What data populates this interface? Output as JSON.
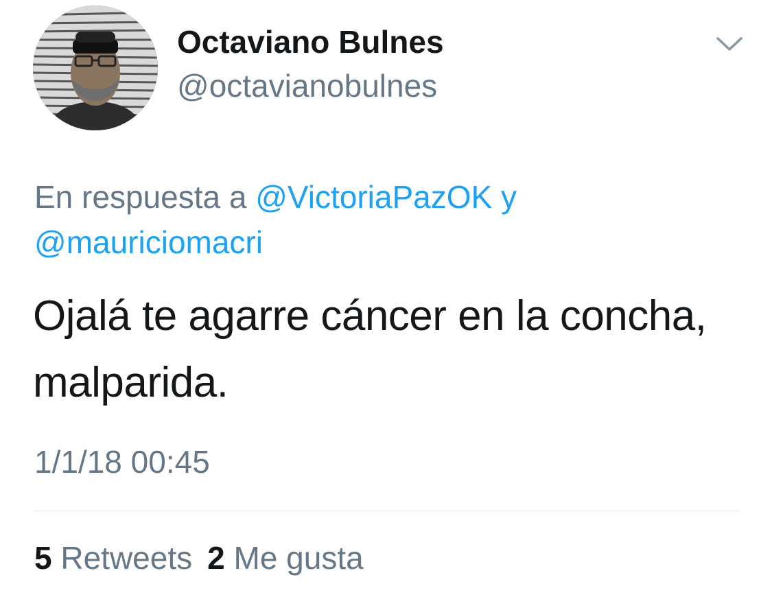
{
  "tweet": {
    "author": {
      "display_name": "Octaviano Bulnes",
      "handle": "@octavianobulnes"
    },
    "reply": {
      "prefix": "En respuesta a",
      "mention_1": "@VictoriaPazOK",
      "joiner": "y",
      "mention_2": "@mauriciomacri"
    },
    "text": "Ojalá te agarre cáncer en la concha, malparida.",
    "timestamp": "1/1/18 00:45",
    "stats": {
      "retweets_count": "5",
      "retweets_label": "Retweets",
      "likes_count": "2",
      "likes_label": "Me gusta"
    }
  },
  "icons": {
    "menu_caret": "chevron-down-icon"
  },
  "colors": {
    "text_primary": "#14171a",
    "text_secondary": "#657786",
    "link": "#1da1f2",
    "divider": "#e1e8ed"
  }
}
